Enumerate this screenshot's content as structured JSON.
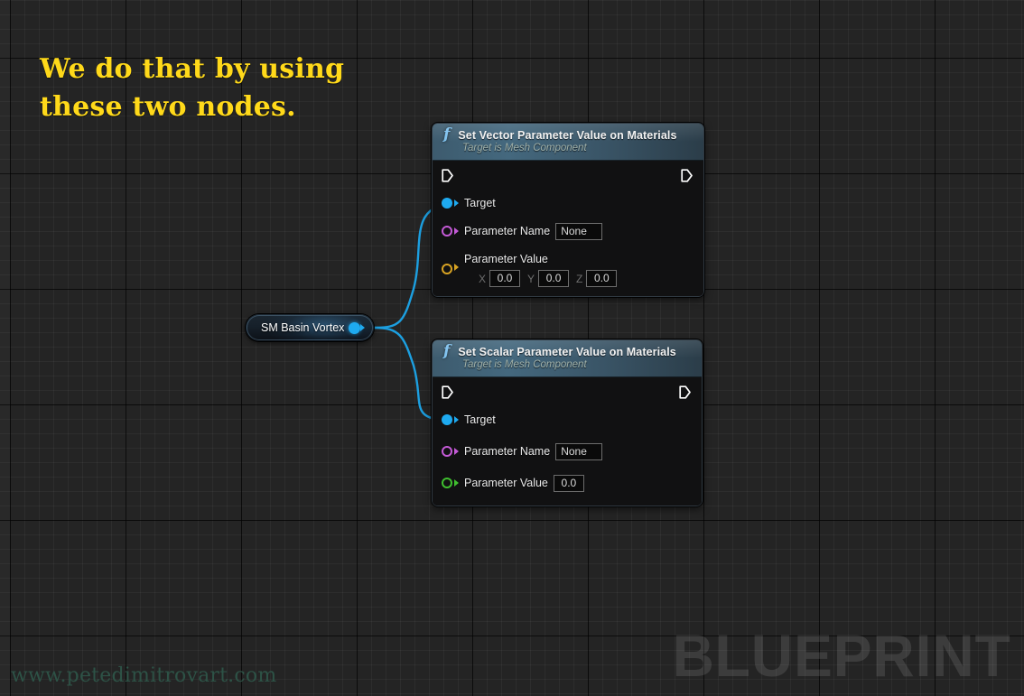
{
  "caption": {
    "text": "We do that by using\nthese two nodes.",
    "color": "#FFD91A"
  },
  "watermarks": {
    "url": "www.petedimitrovart.com",
    "url_color": "#2e5548",
    "logo": "BLUEPRINT"
  },
  "variable_node": {
    "label": "SM Basin Vortex",
    "pin_color": "#1eaaf0"
  },
  "nodes": [
    {
      "title": "Set Vector Parameter Value on Materials",
      "subtitle": "Target is Mesh Component",
      "fn_icon": "f",
      "exec_in": "exec-in-pin",
      "exec_out": "exec-out-pin",
      "pins": [
        {
          "label": "Target",
          "color": "#1eaaf0",
          "style": "filled"
        },
        {
          "label": "Parameter Name",
          "color": "#c45ad6",
          "style": "hollow",
          "value": "None"
        }
      ],
      "vector_pin": {
        "label": "Parameter Value",
        "color": "#d8a323",
        "style": "hollow",
        "axes": [
          {
            "letter": "X",
            "value": "0.0"
          },
          {
            "letter": "Y",
            "value": "0.0"
          },
          {
            "letter": "Z",
            "value": "0.0"
          }
        ]
      }
    },
    {
      "title": "Set Scalar Parameter Value on Materials",
      "subtitle": "Target is Mesh Component",
      "fn_icon": "f",
      "exec_in": "exec-in-pin",
      "exec_out": "exec-out-pin",
      "pins": [
        {
          "label": "Target",
          "color": "#1eaaf0",
          "style": "filled"
        },
        {
          "label": "Parameter Name",
          "color": "#c45ad6",
          "style": "hollow",
          "value": "None"
        },
        {
          "label": "Parameter Value",
          "color": "#3fbf2f",
          "style": "hollow",
          "value": "0.0"
        }
      ]
    }
  ],
  "wires": {
    "color": "#1c9fe0"
  }
}
